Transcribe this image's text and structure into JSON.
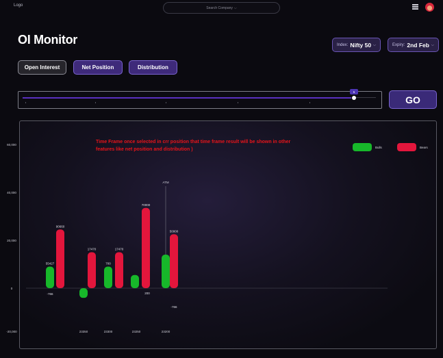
{
  "header": {
    "logo": "Logo",
    "search_placeholder": "Search Company",
    "search_chevron": "⌵"
  },
  "page_title": "OI Monitor",
  "index_select": {
    "label": "Index:",
    "value": "Nifty 50",
    "chevron": "⌵"
  },
  "expiry_select": {
    "label": "Expiry:",
    "value": "2nd Feb",
    "chevron": "⌵"
  },
  "tabs": [
    {
      "label": "Open Interest",
      "active": true
    },
    {
      "label": "Net Position",
      "active": false
    },
    {
      "label": "Distribution",
      "active": false
    }
  ],
  "timeline": {
    "thumb_label": "5",
    "progress": 0.93
  },
  "go_button": "GO",
  "note": "Time Frame once selected in crr position that time frame result will be shown in other features like net position and distribution )",
  "legend": {
    "bulls": {
      "label": "Bulls",
      "color": "#17b82a"
    },
    "bears": {
      "label": "Bears",
      "color": "#e3163c"
    }
  },
  "chart_data": {
    "type": "bar",
    "title": "",
    "xlabel": "",
    "ylabel": "",
    "ylim": [
      -20000,
      60000
    ],
    "y_ticks": [
      {
        "value": 60000,
        "label": "60,000"
      },
      {
        "value": 40000,
        "label": "40,000"
      },
      {
        "value": 20000,
        "label": "20,000"
      },
      {
        "value": 0,
        "label": "0"
      },
      {
        "value": -20000,
        "label": "-20,000"
      }
    ],
    "categories": [
      "",
      "23350",
      "23300",
      "23250",
      "23200"
    ],
    "atm_label": "ATM",
    "atm_category_index": 4,
    "series": [
      {
        "name": "Bulls",
        "color": "#17b82a",
        "values": [
          9000,
          -4500,
          9000,
          5500,
          14000
        ],
        "labels": [
          "55427",
          "",
          "700",
          "",
          ""
        ]
      },
      {
        "name": "Bears",
        "color": "#e3163c",
        "values": [
          24500,
          15000,
          15000,
          33500,
          22500
        ],
        "labels": [
          "90660",
          "17470",
          "17470",
          "70000",
          "50000"
        ]
      }
    ],
    "extra_labels": [
      {
        "category_index": 0,
        "text": "-766"
      },
      {
        "category_index": 3,
        "text": "200"
      },
      {
        "category_index": 4,
        "text": "-766"
      }
    ]
  }
}
